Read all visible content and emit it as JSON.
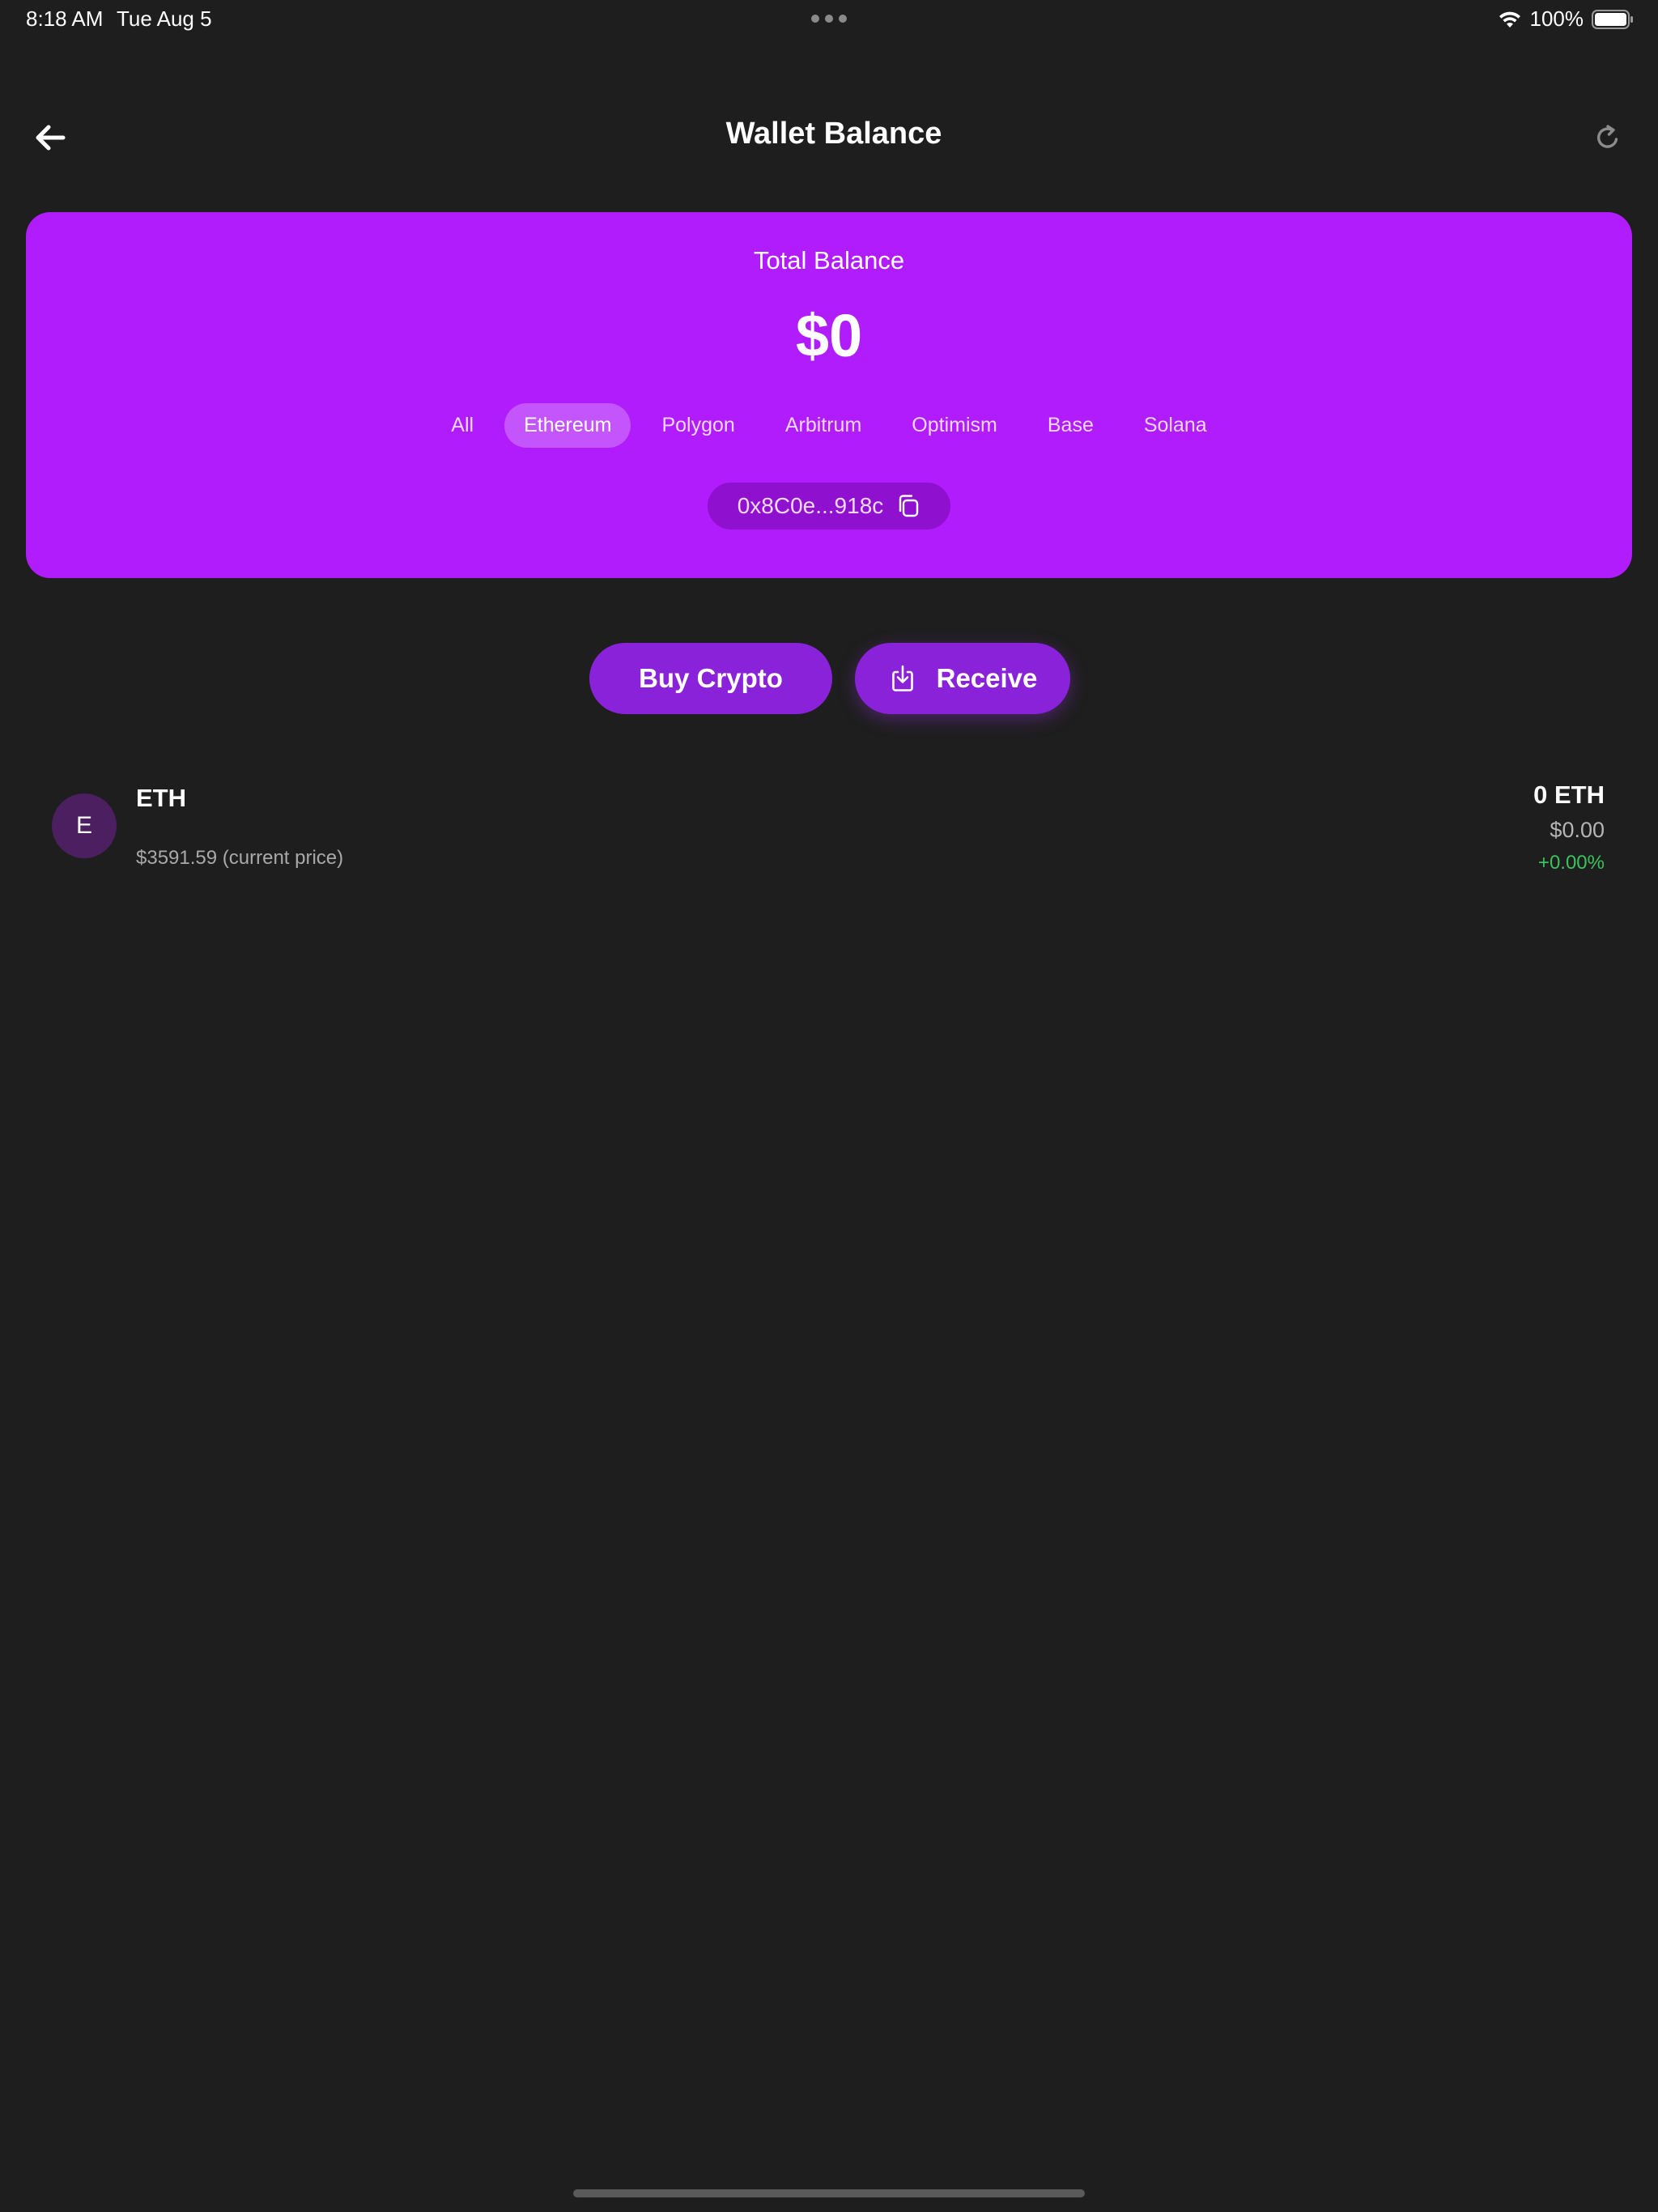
{
  "status_bar": {
    "time": "8:18 AM",
    "date": "Tue Aug 5",
    "battery": "100%",
    "icons": [
      "wifi-icon",
      "battery-icon",
      "more-dots-icon"
    ]
  },
  "header": {
    "title": "Wallet Balance",
    "back_icon": "arrow-left-icon",
    "refresh_icon": "refresh-icon"
  },
  "balance_card": {
    "label": "Total Balance",
    "amount": "$0",
    "color": "#b01cfc",
    "tabs": [
      {
        "label": "All",
        "active": false
      },
      {
        "label": "Ethereum",
        "active": true
      },
      {
        "label": "Polygon",
        "active": false
      },
      {
        "label": "Arbitrum",
        "active": false
      },
      {
        "label": "Optimism",
        "active": false
      },
      {
        "label": "Base",
        "active": false
      },
      {
        "label": "Solana",
        "active": false
      }
    ],
    "address": "0x8C0e...918c",
    "copy_icon": "copy-icon"
  },
  "actions": {
    "buy_label": "Buy Crypto",
    "receive_label": "Receive",
    "receive_icon": "receive-download-icon",
    "button_color": "#8a22d9"
  },
  "tokens": [
    {
      "avatar_letter": "E",
      "symbol": "ETH",
      "price": "$3591.59 (current price)",
      "amount": "0 ETH",
      "value": "$0.00",
      "change": "+0.00%",
      "change_color": "#3ac35c"
    }
  ]
}
